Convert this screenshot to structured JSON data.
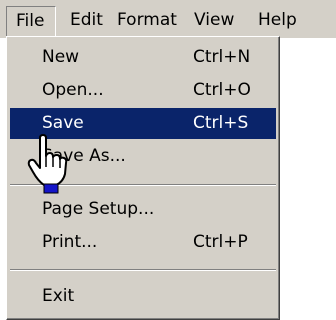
{
  "menubar": {
    "items": [
      {
        "label": "File"
      },
      {
        "label": "Edit"
      },
      {
        "label": "Format"
      },
      {
        "label": "View"
      },
      {
        "label": "Help"
      }
    ]
  },
  "file_menu": {
    "items": [
      {
        "label": "New",
        "shortcut": "Ctrl+N"
      },
      {
        "label": "Open...",
        "shortcut": "Ctrl+O"
      },
      {
        "label": "Save",
        "shortcut": "Ctrl+S"
      },
      {
        "label": "Save As...",
        "shortcut": ""
      },
      {
        "label": "Page Setup...",
        "shortcut": ""
      },
      {
        "label": "Print...",
        "shortcut": "Ctrl+P"
      },
      {
        "label": "Exit",
        "shortcut": ""
      }
    ],
    "highlighted_item": "Save"
  },
  "colors": {
    "menu_bg": "#d4d0c8",
    "highlight_bg": "#0a246a",
    "highlight_text": "#ffffff"
  },
  "cursor": {
    "icon": "hand-pointer-icon"
  }
}
